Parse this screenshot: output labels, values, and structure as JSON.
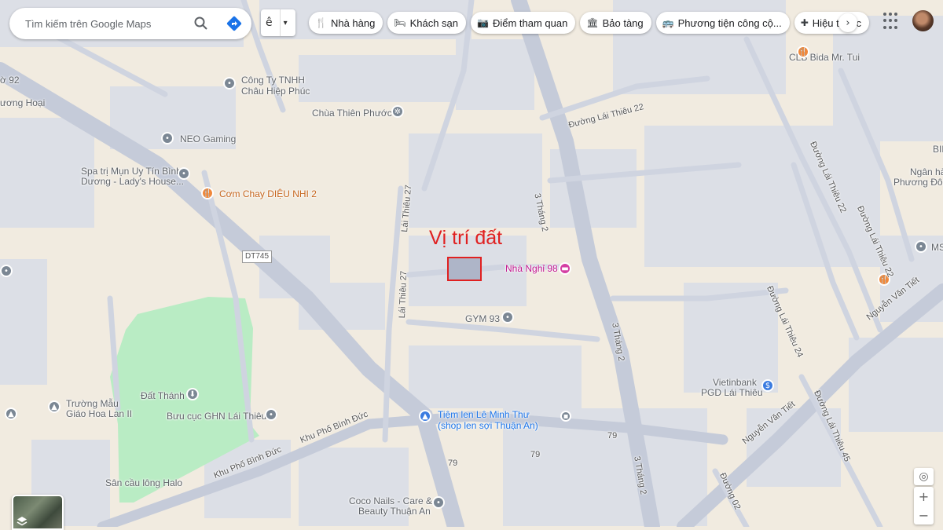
{
  "search": {
    "placeholder": "Tìm kiếm trên Google Maps"
  },
  "ime": {
    "char": "ê",
    "arrow": "▾"
  },
  "chips": [
    {
      "label": "Nhà hàng",
      "icon": "🍴"
    },
    {
      "label": "Khách sạn",
      "icon": "🛏"
    },
    {
      "label": "Điểm tham quan",
      "icon": "📷"
    },
    {
      "label": "Bảo tàng",
      "icon": "🏛"
    },
    {
      "label": "Phương tiện công cộ...",
      "icon": "🚌"
    },
    {
      "label": "Hiệu thuốc",
      "icon": "✚"
    }
  ],
  "annotation": {
    "title": "Vị trí đất",
    "color": "#e02020"
  },
  "places": {
    "cong_ty": [
      "Công Ty TNHH",
      "Châu Hiệp Phúc"
    ],
    "chua": "Chùa Thiên Phước",
    "neo": "NEO Gaming",
    "spa": [
      "Spa trị Mụn Uy Tín Bình",
      "Dương - Lady's House..."
    ],
    "com_chay": "Cơm Chay DIỆU NHI 2",
    "nha_nghi": "Nhà Nghỉ 98",
    "gym": "GYM 93",
    "dat_thanh": "Đất Thánh",
    "buu_cuc": "Bưu cục GHN Lái Thiêu",
    "truong_mau": [
      "Trường Mẫu",
      "Giáo Hoa Lan II"
    ],
    "tiem_len": [
      "Tiệm len Lê Minh Thư",
      "(shop len sợi Thuận An)"
    ],
    "vietinbank": [
      "Vietinbank",
      "PGD Lái Thiêu"
    ],
    "coco": [
      "Coco Nails - Care &",
      "Beauty Thuận An"
    ],
    "san_cau": "Sân cầu lông Halo",
    "clb": "CLB Bida Mr. Tui",
    "ngan_hang": [
      "Ngân hà",
      "Phương Đôn"
    ],
    "bid": "BID",
    "ms": "MS",
    "edge_92": "ờ 92",
    "edge_hoi": "ương Hoại"
  },
  "roads": {
    "dt745": "DT745",
    "ba_thang_hai": "3 Tháng 2",
    "lai_thieu_27": "Lái Thiêu 27",
    "lai_thieu_22": "Đường Lái Thiêu 22",
    "lai_thieu_24": "Đường Lái Thiêu 24",
    "lai_thieu_45": "Đường Lái Thiêu 45",
    "nguyen_van_tiet": "Nguyễn Văn Tiết",
    "khu_pho": "Khu Phố Bình Đức",
    "so_79": "79",
    "duong_02": "Đường 02"
  },
  "colors": {
    "road": "#c5cbd9",
    "block": "#dcdfe6",
    "land": "#f1ebe0",
    "park": "#b9ecc4",
    "accent_pin": "#f0883b"
  }
}
